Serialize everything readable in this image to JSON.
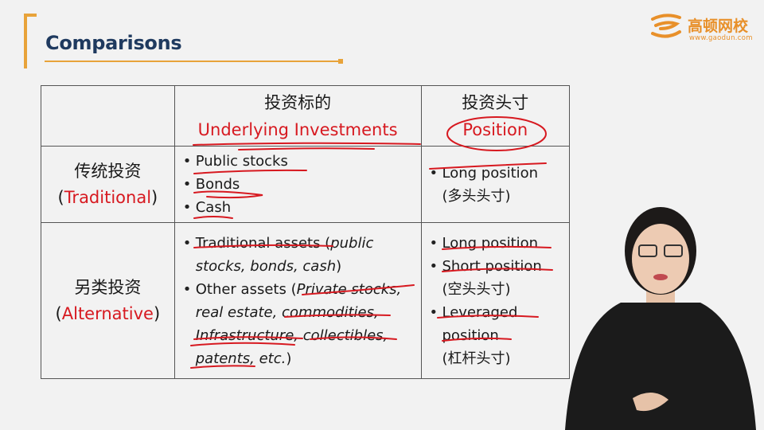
{
  "slide": {
    "title": "Comparisons"
  },
  "logo": {
    "name": "高顿网校",
    "url": "www.gaodun.com"
  },
  "table": {
    "header": {
      "col_a_cn": "投资标的",
      "col_a_en": "Underlying Investments",
      "col_b_cn": "投资头寸",
      "col_b_en": "Position"
    },
    "rows": [
      {
        "label_cn": "传统投资",
        "label_en": "Traditional",
        "assets": [
          "Public stocks",
          "Bonds",
          "Cash"
        ],
        "positions": [
          "Long position",
          "(多头头寸)"
        ]
      },
      {
        "label_cn": "另类投资",
        "label_en": "Alternative",
        "assets": [
          "Traditional assets (",
          "public",
          "stocks, bonds, cash",
          ")",
          "Other assets (",
          "Private stocks,",
          "real estate, commodities,",
          "Infrastructure, collectibles,",
          "patents, etc.",
          ")"
        ],
        "positions": [
          "Long position",
          "Short position",
          "(空头头寸)",
          "Leveraged",
          "position",
          "(杠杆头寸)"
        ]
      }
    ]
  },
  "colors": {
    "accent": "#e8a33a",
    "title": "#1f3a5f",
    "annotation": "#d71920"
  }
}
